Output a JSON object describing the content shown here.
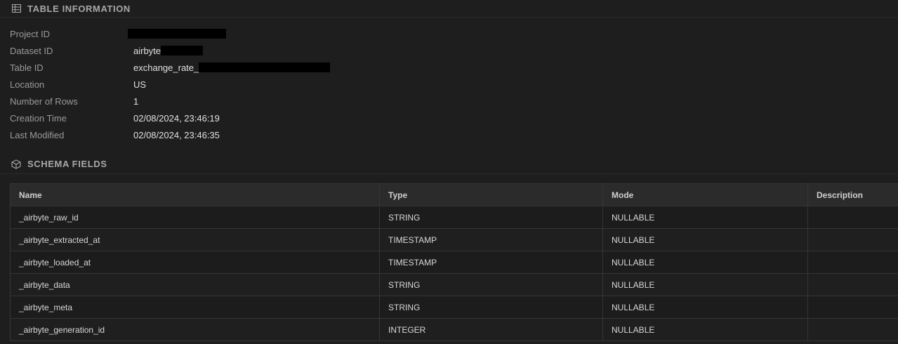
{
  "table_info": {
    "title": "TABLE INFORMATION",
    "rows": [
      {
        "label": "Project ID",
        "value": "",
        "redacted": true
      },
      {
        "label": "Dataset ID",
        "value": "airbyte",
        "redacted": true
      },
      {
        "label": "Table ID",
        "value": "exchange_rate_",
        "redacted": true
      },
      {
        "label": "Location",
        "value": "US"
      },
      {
        "label": "Number of Rows",
        "value": "1"
      },
      {
        "label": "Creation Time",
        "value": "02/08/2024, 23:46:19"
      },
      {
        "label": "Last Modified",
        "value": "02/08/2024, 23:46:35"
      }
    ]
  },
  "schema": {
    "title": "SCHEMA FIELDS",
    "columns": [
      "Name",
      "Type",
      "Mode",
      "Description"
    ],
    "rows": [
      [
        "_airbyte_raw_id",
        "STRING",
        "NULLABLE",
        ""
      ],
      [
        "_airbyte_extracted_at",
        "TIMESTAMP",
        "NULLABLE",
        ""
      ],
      [
        "_airbyte_loaded_at",
        "TIMESTAMP",
        "NULLABLE",
        ""
      ],
      [
        "_airbyte_data",
        "STRING",
        "NULLABLE",
        ""
      ],
      [
        "_airbyte_meta",
        "STRING",
        "NULLABLE",
        ""
      ],
      [
        "_airbyte_generation_id",
        "INTEGER",
        "NULLABLE",
        ""
      ]
    ]
  },
  "icons": {
    "table_info": "table-grid-icon",
    "schema": "cube-icon"
  }
}
